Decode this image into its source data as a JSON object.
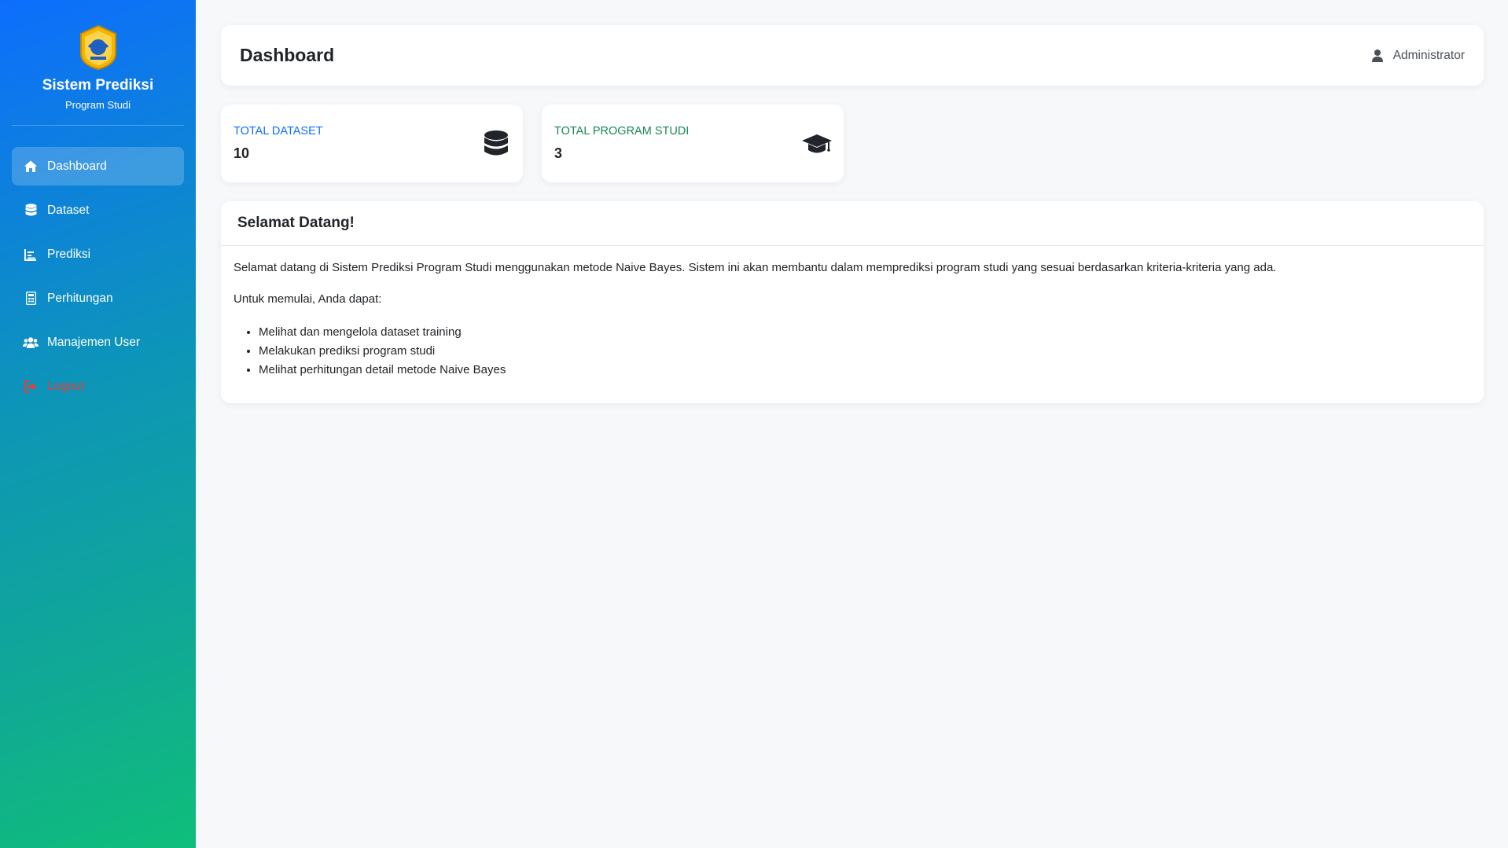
{
  "sidebar": {
    "brand_title": "Sistem Prediksi",
    "brand_subtitle": "Program Studi",
    "items": [
      {
        "label": "Dashboard",
        "icon": "home-icon"
      },
      {
        "label": "Dataset",
        "icon": "database-icon"
      },
      {
        "label": "Prediksi",
        "icon": "chart-icon"
      },
      {
        "label": "Perhitungan",
        "icon": "calculator-icon"
      },
      {
        "label": "Manajemen User",
        "icon": "users-icon"
      },
      {
        "label": "Logout",
        "icon": "logout-icon"
      }
    ]
  },
  "header": {
    "title": "Dashboard",
    "user_name": "Administrator"
  },
  "cards": [
    {
      "label": "Total Dataset",
      "value": "10",
      "icon": "database-icon",
      "color": "#0d6efd"
    },
    {
      "label": "Total Program Studi",
      "value": "3",
      "icon": "graduation-cap-icon",
      "color": "#198754"
    }
  ],
  "welcome": {
    "title": "Selamat Datang!",
    "intro": "Selamat datang di Sistem Prediksi Program Studi menggunakan metode Naive Bayes. Sistem ini akan membantu dalam memprediksi program studi yang sesuai berdasarkan kriteria-kriteria yang ada.",
    "start_text": "Untuk memulai, Anda dapat:",
    "items": [
      "Melihat dan mengelola dataset training",
      "Melakukan prediksi program studi",
      "Melihat perhitungan detail metode Naive Bayes"
    ]
  },
  "colors": {
    "primary": "#0d6efd",
    "success": "#198754",
    "danger": "#e53e3e"
  }
}
